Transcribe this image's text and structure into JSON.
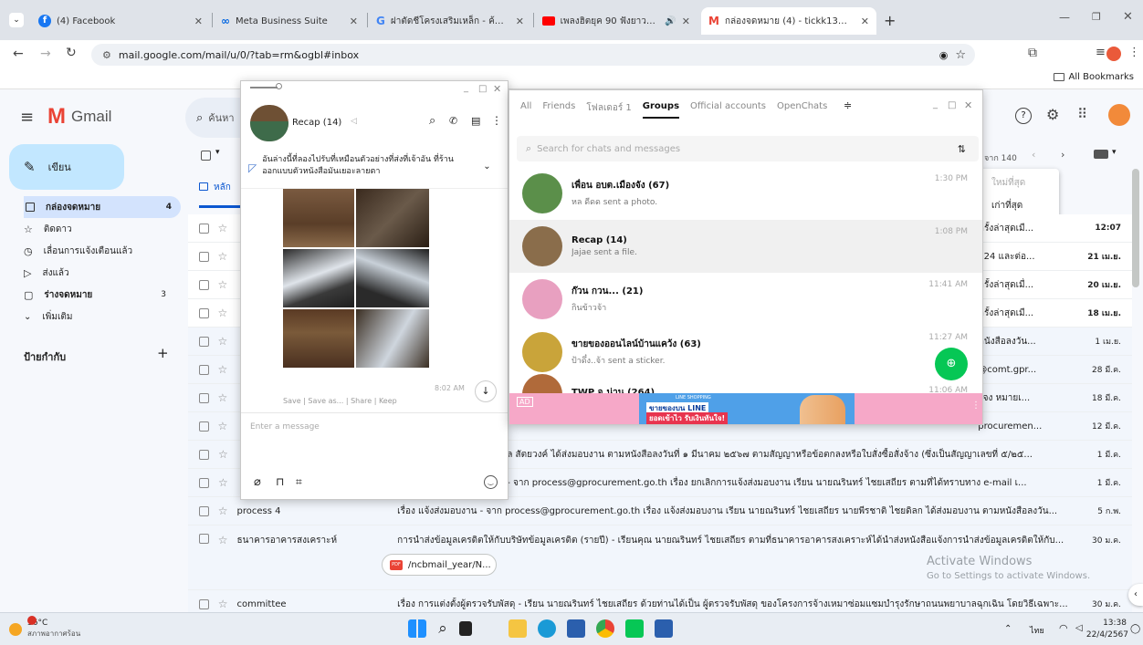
{
  "browser": {
    "tabs": [
      {
        "title": "(4) Facebook"
      },
      {
        "title": "Meta Business Suite"
      },
      {
        "title": "ฝาตัดชีโครงเสริมเหล็ก - ค้นหาด้วย G"
      },
      {
        "title": "เพลงฮิตยุค 90 ฟังยาวแบบต่อเนื่อ"
      },
      {
        "title": "กล่องจดหมาย (4) - tickk1313@gm"
      }
    ],
    "url": "mail.google.com/mail/u/0/?tab=rm&ogbl#inbox",
    "all_bookmarks": "All Bookmarks"
  },
  "gmail": {
    "logo": "Gmail",
    "search_placeholder": "ค้นหา",
    "compose": "เขียน",
    "nav": [
      {
        "label": "กล่องจดหมาย",
        "count": "4"
      },
      {
        "label": "ติดดาว",
        "count": ""
      },
      {
        "label": "เลื่อนการแจ้งเตือนแล้ว",
        "count": ""
      },
      {
        "label": "ส่งแล้ว",
        "count": ""
      },
      {
        "label": "ร่างจดหมาย",
        "count": "3"
      },
      {
        "label": "เพิ่มเติม",
        "count": ""
      }
    ],
    "labels_title": "ป้ายกำกับ",
    "primary_tab": "หลัก",
    "pagination": "จาก 140",
    "sort_menu": [
      "ใหม่ที่สุด",
      "เก่าที่สุด"
    ],
    "rows": [
      {
        "sender": "",
        "subject": "ครั้งล่าสุดเมื...",
        "date": "12:07",
        "unread": true
      },
      {
        "sender": "",
        "subject": "024 และต่อ...",
        "date": "21 เม.ย.",
        "unread": true
      },
      {
        "sender": "",
        "subject": "ครั้งล่าสุดเมื่...",
        "date": "20 เม.ย.",
        "unread": true
      },
      {
        "sender": "",
        "subject": "ครั้งล่าสุดเมื...",
        "date": "18 เม.ย.",
        "unread": true
      },
      {
        "sender": "",
        "subject": "หนังสือลงวัน...",
        "date": "1 เม.ย.",
        "unread": false
      },
      {
        "sender": "",
        "subject": "@comt.gpr...",
        "date": "28 มี.ค.",
        "unread": false
      },
      {
        "sender": "",
        "subject": "ะจง หมายเ...",
        "date": "18 มี.ค.",
        "unread": false
      },
      {
        "sender": "",
        "subject": "procuremen...",
        "date": "12 มี.ค.",
        "unread": false
      },
      {
        "sender": "",
        "subject": "ล สัตยวงค์ ได้ส่งมอบงาน ตามหนังสือลงวันที่ ๑ มีนาคม ๒๕๖๗ ตามสัญญาหรือข้อตกลงหรือใบสั่งซื้อสั่งจ้าง (ซึ่งเป็นสัญญาเลขที่ ๕/๒๕...",
        "date": "1 มี.ค.",
        "unread": false
      },
      {
        "sender": "",
        "subject": "- จาก process@gprocurement.go.th เรื่อง ยกเลิกการแจ้งส่งมอบงาน เรียน นายณรินทร์ ไชยเสถียร ตามที่ได้ทราบทาง e-mail เ...",
        "date": "1 มี.ค.",
        "unread": false
      },
      {
        "sender": "process 4",
        "subject": "เรื่อง แจ้งส่งมอบงาน - จาก process@gprocurement.go.th เรื่อง แจ้งส่งมอบงาน เรียน นายณรินทร์ ไชยเสถียร นายพีรชาติ ไชยดิลก ได้ส่งมอบงาน ตามหนังสือลงวัน...",
        "date": "5 ก.พ.",
        "unread": false
      },
      {
        "sender": "ธนาคารอาคารสงเคราะห์",
        "subject": "การนำส่งข้อมูลเครดิตให้กับบริษัทข้อมูลเครดิต (รายปี) - เรียนคุณ นายณรินทร์ ไชยเสถียร ตามที่ธนาคารอาคารสงเคราะห์ได้นำส่งหนังสือแจ้งการนำส่งข้อมูลเครดิตให้กับ...",
        "date": "30 ม.ค.",
        "unread": false
      },
      {
        "sender": "committee",
        "subject": "เรื่อง การแต่งตั้งผู้ตรวจรับพัสดุ - เรียน นายณรินทร์ ไชยเสถียร ด้วยท่านได้เป็น ผู้ตรวจรับพัสดุ ของโครงการจ้างเหมาซ่อมแซมบำรุงรักษาถนนพยาบาลฉุกเฉิน โดยวิธีเฉพาะ...",
        "date": "30 ม.ค.",
        "unread": false
      }
    ],
    "attachment": "/ncbmail_year/N...",
    "watermark": {
      "title": "Activate Windows",
      "sub": "Go to Settings to activate Windows."
    }
  },
  "line_chat": {
    "title": "Recap (14)",
    "pinned": "อันล่างนี้ที่ลองไปรับที่เหมือนตัวอย่างที่ส่งที่เจ้าอัน ที่ร้านออกแบบตัวหนังสือมันเยอะลายตา",
    "time": "8:02 AM",
    "actions": "Save | Save as... | Share | Keep",
    "input_placeholder": "Enter a message"
  },
  "line_list": {
    "tabs": [
      "All",
      "Friends",
      "โฟลเดอร์ 1",
      "Groups",
      "Official accounts",
      "OpenChats"
    ],
    "active_tab": "Groups",
    "search_placeholder": "Search for chats and messages",
    "chats": [
      {
        "name": "เพื่อน อบต.เมืองจัง (67)",
        "preview": "หล ดีดด sent a photo.",
        "time": "1:30 PM",
        "color": "#5b8f4a"
      },
      {
        "name": "Recap (14)",
        "preview": "Jajae sent a file.",
        "time": "1:08 PM",
        "color": "#8a6d4b"
      },
      {
        "name": "ก๊วน กวน... (21)",
        "preview": "กินข้าวจ้า",
        "time": "11:41 AM",
        "color": "#e8a0c0"
      },
      {
        "name": "ขายของออนไลน์บ้านแคว้ง (63)",
        "preview": "ป้าดึ๋ง..จ้า sent a sticker.",
        "time": "11:27 AM",
        "color": "#c9a43a"
      },
      {
        "name": "TWP จ.น่าน (264)",
        "preview": "",
        "time": "11:06 AM",
        "color": "#b06a3a"
      }
    ],
    "ad_label": "AD",
    "ad_top": "LINE SHOPPING",
    "ad_main1": "ขายของบน LINE",
    "ad_main2": "ยอดเข้าไว รับเงินทันใจ!"
  },
  "taskbar": {
    "temp": "36°C",
    "weather": "สภาพอากาศร้อน",
    "lang": "ไทย",
    "time": "13:38",
    "date": "22/4/2567"
  }
}
